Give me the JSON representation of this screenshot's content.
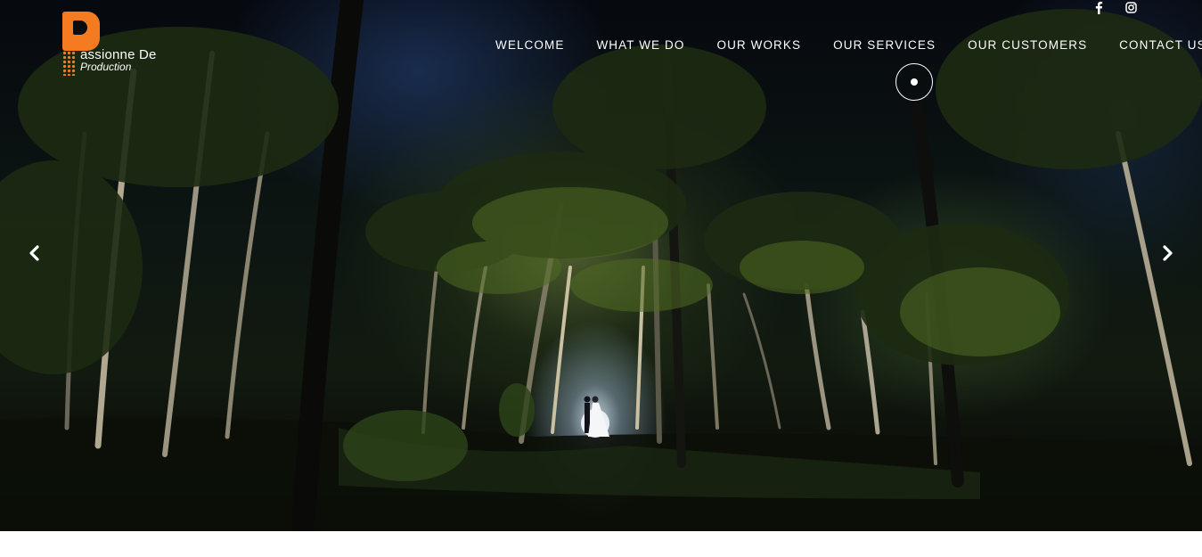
{
  "brand": {
    "logo_line1": "assionne De",
    "logo_line2": "Production",
    "logo_letter": "P",
    "accent_color": "#f47b20"
  },
  "social": [
    {
      "name": "facebook-icon",
      "glyph": "f"
    },
    {
      "name": "instagram-icon",
      "glyph": "◎"
    }
  ],
  "nav": {
    "items": [
      {
        "label": "WELCOME"
      },
      {
        "label": "WHAT WE DO"
      },
      {
        "label": "OUR WORKS"
      },
      {
        "label": "OUR SERVICES"
      },
      {
        "label": "OUR CUSTOMERS"
      },
      {
        "label": "CONTACT US"
      }
    ]
  },
  "slider": {
    "prev_icon": "chevron-left-icon",
    "next_icon": "chevron-right-icon",
    "slide_image": "night-palm-grove-couple"
  }
}
